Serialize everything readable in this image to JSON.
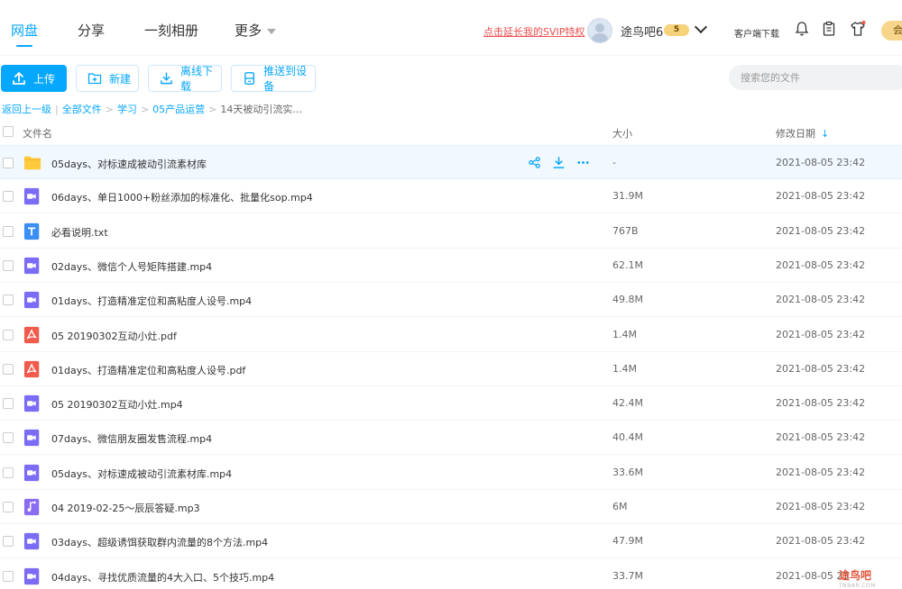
{
  "nav": {
    "tabs": [
      "网盘",
      "分享",
      "一刻相册",
      "更多"
    ],
    "svip_link": "点击延长我的SVIP特权",
    "username": "途鸟吧6",
    "vip_level": "5",
    "client_download": "客户端下载",
    "member_label": "会"
  },
  "toolbar": {
    "upload": "上传",
    "new": "新建",
    "offline_download": "离线下载",
    "push_device": "推送到设备",
    "search_placeholder": "搜索您的文件"
  },
  "breadcrumb": {
    "back": "返回上一级",
    "items": [
      "全部文件",
      "学习",
      "05产品运营"
    ],
    "current": "14天被动引流实..."
  },
  "table": {
    "col_name": "文件名",
    "col_size": "大小",
    "col_date": "修改日期",
    "sort_icon": "arrow-down"
  },
  "files": [
    {
      "name": "05days、对标速成被动引流素材库",
      "size": "-",
      "date": "2021-08-05 23:42",
      "type": "folder"
    },
    {
      "name": "06days、单日1000+粉丝添加的标准化、批量化sop.mp4",
      "size": "31.9M",
      "date": "2021-08-05 23:42",
      "type": "video"
    },
    {
      "name": "必看说明.txt",
      "size": "767B",
      "date": "2021-08-05 23:42",
      "type": "text"
    },
    {
      "name": "02days、微信个人号矩阵搭建.mp4",
      "size": "62.1M",
      "date": "2021-08-05 23:42",
      "type": "video"
    },
    {
      "name": "01days、打造精准定位和高粘度人设号.mp4",
      "size": "49.8M",
      "date": "2021-08-05 23:42",
      "type": "video"
    },
    {
      "name": "05 20190302互动小灶.pdf",
      "size": "1.4M",
      "date": "2021-08-05 23:42",
      "type": "pdf"
    },
    {
      "name": "01days、打造精准定位和高粘度人设号.pdf",
      "size": "1.4M",
      "date": "2021-08-05 23:42",
      "type": "pdf"
    },
    {
      "name": "05 20190302互动小灶.mp4",
      "size": "42.4M",
      "date": "2021-08-05 23:42",
      "type": "video"
    },
    {
      "name": "07days、微信朋友圈发售流程.mp4",
      "size": "40.4M",
      "date": "2021-08-05 23:42",
      "type": "video"
    },
    {
      "name": "05days、对标速成被动引流素材库.mp4",
      "size": "33.6M",
      "date": "2021-08-05 23:42",
      "type": "video"
    },
    {
      "name": "04 2019-02-25～辰辰答疑.mp3",
      "size": "6M",
      "date": "2021-08-05 23:42",
      "type": "audio"
    },
    {
      "name": "03days、超级诱饵获取群内流量的8个方法.mp4",
      "size": "47.9M",
      "date": "2021-08-05 23:42",
      "type": "video"
    },
    {
      "name": "04days、寻找优质流量的4大入口、5个技巧.mp4",
      "size": "33.7M",
      "date": "2021-08-05 23",
      "type": "video"
    }
  ],
  "watermark": {
    "text": "途鸟吧",
    "sub": "TNBAR.COM"
  },
  "colors": {
    "accent": "#06a7ff",
    "folder": "#ffc93c",
    "video": "#7b6cf6",
    "pdf": "#f15b4d",
    "text": "#3b8ef5",
    "audio": "#8a6cf0"
  }
}
